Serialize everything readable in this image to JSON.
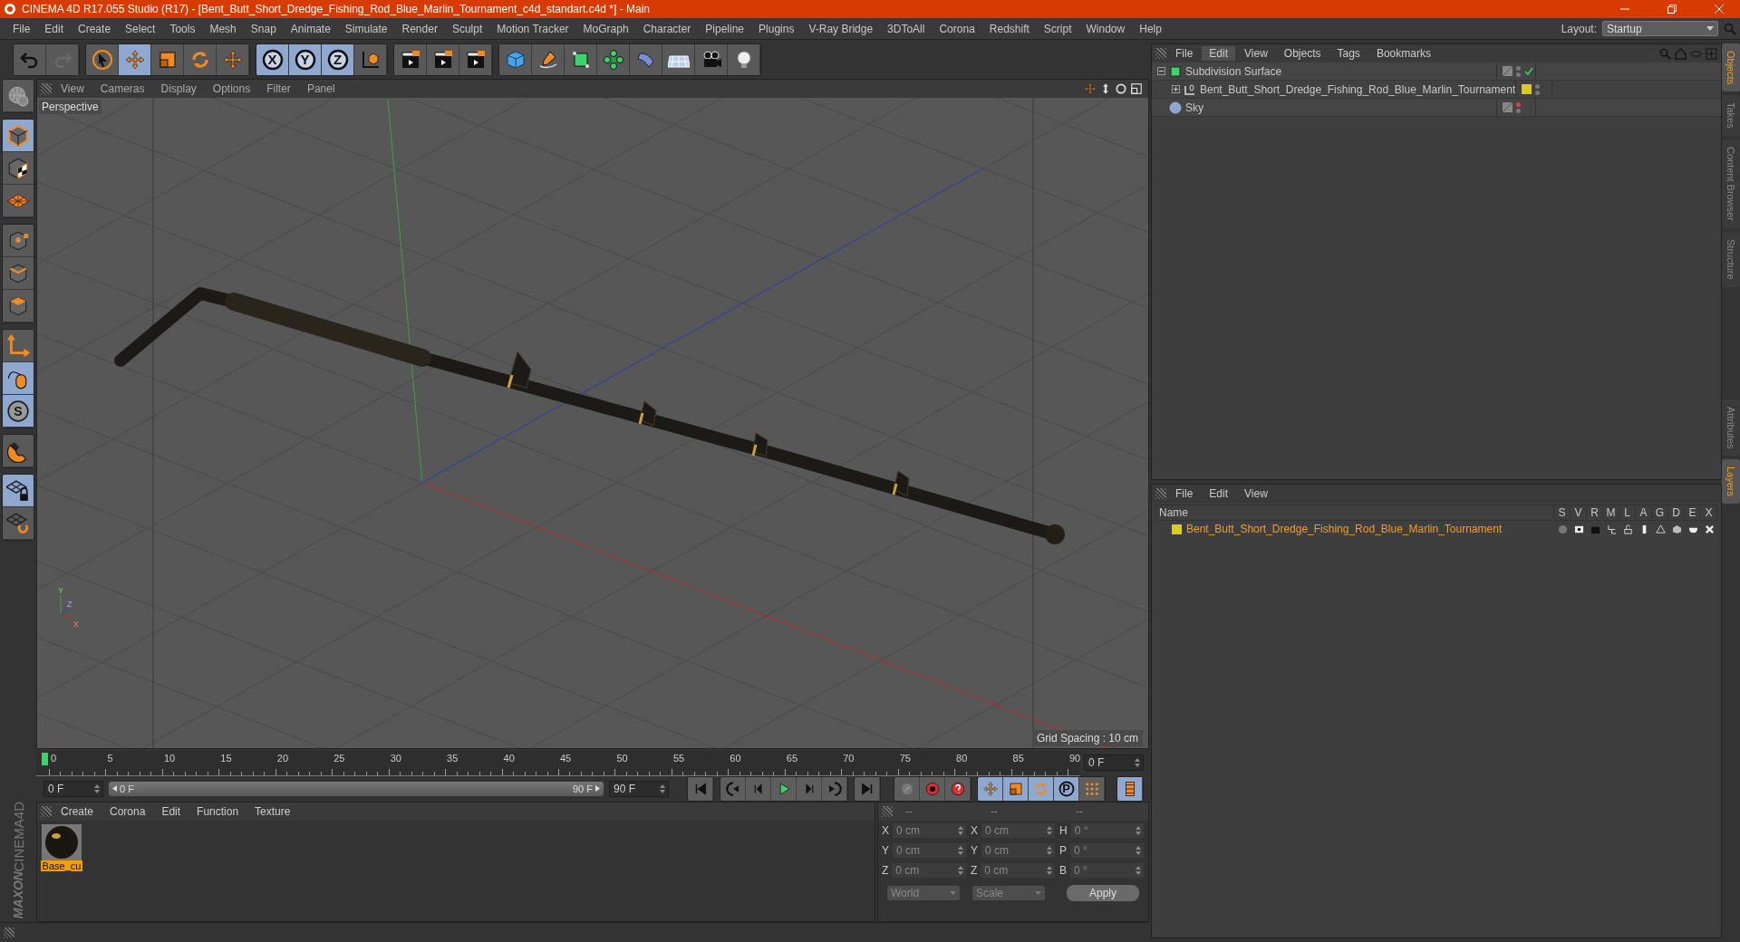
{
  "window": {
    "title": "CINEMA 4D R17.055 Studio (R17) - [Bent_Butt_Short_Dredge_Fishing_Rod_Blue_Marlin_Tournament_c4d_standart.c4d *] - Main"
  },
  "menu": [
    "File",
    "Edit",
    "Create",
    "Select",
    "Tools",
    "Mesh",
    "Snap",
    "Animate",
    "Simulate",
    "Render",
    "Sculpt",
    "Motion Tracker",
    "MoGraph",
    "Character",
    "Pipeline",
    "Plugins",
    "V-Ray Bridge",
    "3DToAll",
    "Corona",
    "Redshift",
    "Script",
    "Window",
    "Help"
  ],
  "layout": {
    "label": "Layout:",
    "value": "Startup"
  },
  "toolbar": [
    [
      {
        "active": false
      },
      {
        "active": false
      }
    ],
    [
      {
        "active": false
      },
      {
        "active": true
      },
      {
        "active": false
      },
      {
        "active": false
      },
      {
        "active": false
      }
    ],
    [
      {
        "active": true,
        "label": "X"
      },
      {
        "active": true,
        "label": "Y"
      },
      {
        "active": true,
        "label": "Z"
      },
      {
        "active": false
      }
    ],
    [
      {
        "active": false
      },
      {
        "active": false
      },
      {
        "active": false
      }
    ],
    [
      {
        "active": false
      },
      {
        "active": false
      },
      {
        "active": false
      },
      {
        "active": false
      },
      {
        "active": false
      },
      {
        "active": false
      },
      {
        "active": false
      },
      {
        "active": false
      }
    ]
  ],
  "tools_left": [
    [
      {
        "active": false
      }
    ],
    [
      {
        "active": true
      },
      {
        "active": false
      },
      {
        "active": false
      }
    ],
    [
      {
        "active": false
      },
      {
        "active": false
      },
      {
        "active": false
      }
    ],
    [
      {
        "active": false
      },
      {
        "active": true
      },
      {
        "active": true,
        "label": "S"
      }
    ],
    [
      {
        "active": false
      }
    ],
    [
      {
        "active": true
      },
      {
        "active": false
      }
    ]
  ],
  "viewport": {
    "menu": [
      "View",
      "Cameras",
      "Display",
      "Options",
      "Filter",
      "Panel"
    ],
    "camera": "Perspective",
    "grid_spacing": "Grid Spacing : 10 cm",
    "axis_labels": [
      "Y",
      "Z",
      "X"
    ]
  },
  "timeline": {
    "ticks": [
      "0",
      "5",
      "10",
      "15",
      "20",
      "25",
      "30",
      "35",
      "40",
      "45",
      "50",
      "55",
      "60",
      "65",
      "70",
      "75",
      "80",
      "85",
      "90"
    ],
    "current_frame": "0 F",
    "start": "0 F",
    "range": {
      "start": "0 F",
      "end": "90 F",
      "level": 1
    },
    "end": "90 F"
  },
  "keying": [
    {
      "active": false
    },
    {
      "active": false
    },
    {
      "active": false
    },
    {
      "active": true
    },
    {
      "active": true
    },
    {
      "active": true
    },
    {
      "active": true,
      "label": "P"
    },
    {
      "active": false
    }
  ],
  "timeline_button": {
    "active": true
  },
  "materials": {
    "menu": [
      "Create",
      "Corona",
      "Edit",
      "Function",
      "Texture"
    ],
    "items": [
      {
        "name": "Base_cu",
        "selected": true
      }
    ]
  },
  "coordinates": {
    "headers": [
      "--",
      "--",
      "--"
    ],
    "rows": [
      [
        {
          "axis": "X",
          "value": "0 cm"
        },
        {
          "axis": "X",
          "value": "0 cm"
        },
        {
          "axis": "H",
          "value": "0 °"
        }
      ],
      [
        {
          "axis": "Y",
          "value": "0 cm"
        },
        {
          "axis": "Y",
          "value": "0 cm"
        },
        {
          "axis": "P",
          "value": "0 °"
        }
      ],
      [
        {
          "axis": "Z",
          "value": "0 cm"
        },
        {
          "axis": "Z",
          "value": "0 cm"
        },
        {
          "axis": "B",
          "value": "0 °"
        }
      ]
    ],
    "mode": "World",
    "transform": "Scale",
    "apply": "Apply"
  },
  "objects": {
    "menu": [
      {
        "label": "File",
        "selected": false
      },
      {
        "label": "Edit",
        "selected": true
      },
      {
        "label": "View",
        "selected": false
      },
      {
        "label": "Objects",
        "selected": false
      },
      {
        "label": "Tags",
        "selected": false
      },
      {
        "label": "Bookmarks",
        "selected": false
      }
    ],
    "tree": [
      {
        "name": "Subdivision Surface",
        "kind": "subdivision",
        "expanded": true,
        "enabled": true,
        "editor_visible": true,
        "children": [
          {
            "name": "Bent_Butt_Short_Dredge_Fishing_Rod_Blue_Marlin_Tournament",
            "kind": "null",
            "expanded": false,
            "enabled": false,
            "editor_visible": true,
            "color": "#d8cc20"
          }
        ]
      },
      {
        "name": "Sky",
        "kind": "sky",
        "enabled": false,
        "editor_visible": false
      }
    ]
  },
  "layers": {
    "menu": [
      "File",
      "Edit",
      "View"
    ],
    "columns": [
      "Name",
      "S",
      "V",
      "R",
      "M",
      "L",
      "A",
      "G",
      "D",
      "E",
      "X"
    ],
    "rows": [
      {
        "name": "Bent_Butt_Short_Dredge_Fishing_Rod_Blue_Marlin_Tournament",
        "color": "#d8cc20"
      }
    ]
  },
  "side_tabs_top": [
    {
      "label": "Objects",
      "selected": true
    },
    {
      "label": "Takes",
      "selected": false
    },
    {
      "label": "Content Browser",
      "selected": false
    },
    {
      "label": "Structure",
      "selected": false
    }
  ],
  "side_tabs_bottom": [
    {
      "label": "Attributes",
      "selected": false
    },
    {
      "label": "Layers",
      "selected": true
    }
  ],
  "brand": [
    "MAXON",
    "CINEMA4D"
  ]
}
